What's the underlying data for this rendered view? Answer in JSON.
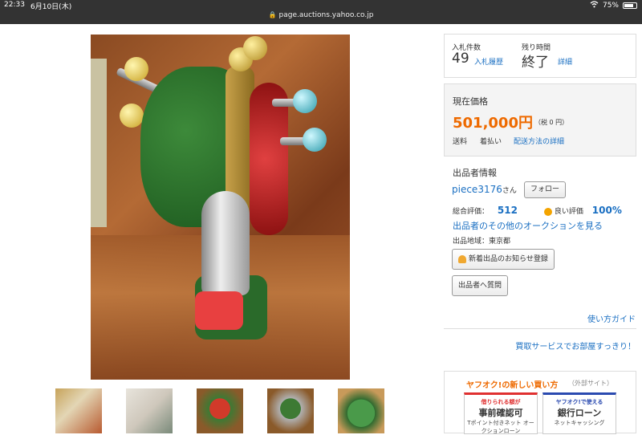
{
  "status_bar": {
    "time": "22:33",
    "date": "6月10日(木)",
    "battery": "75%",
    "battery_level": 0.75
  },
  "url_bar": {
    "url": "page.auctions.yahoo.co.jp"
  },
  "bids": {
    "count_label": "入札件数",
    "count": "49",
    "history_link": "入札履歴",
    "time_left_label": "残り時間",
    "time_left": "終了",
    "detail_link": "詳細"
  },
  "price": {
    "label": "現在価格",
    "value": "501,000円",
    "tax": "（税 0 円）",
    "shipping_label": "送料",
    "shipping_value": "着払い",
    "shipping_link": "配送方法の詳細"
  },
  "seller": {
    "section_title": "出品者情報",
    "name": "piece3176",
    "honorific": "さん",
    "follow_button": "フォロー",
    "total_rating_label": "総合評価：",
    "total_rating": "512",
    "good_rating_label": "良い評価",
    "good_rating": "100%",
    "other_auctions_link": "出品者のその他のオークションを見る",
    "region": "出品地域：東京都",
    "notify_button": "新着出品のお知らせ登録",
    "question_button": "出品者へ質問"
  },
  "links": {
    "how_to": "使い方ガイド",
    "service": "買取サービスでお部屋すっきり！"
  },
  "new_way": {
    "title": "ヤフオク!の新しい買い方",
    "external": "（外部サイト）",
    "card1": {
      "caption": "借りられる額が",
      "big": "事前確認可",
      "small": "Tポイント付きネット\nオークションローン"
    },
    "card2": {
      "caption": "ヤフオク!で使える",
      "big": "銀行ローン",
      "small": "ネットキャッシング"
    }
  },
  "icons": {
    "lock": "lock-icon",
    "wifi": "wifi-icon",
    "bell": "bell-icon",
    "sun": "sun-icon"
  },
  "colors": {
    "price_orange": "#ee6a00",
    "link_blue": "#1a6fc2",
    "bar_dark": "#333333"
  }
}
